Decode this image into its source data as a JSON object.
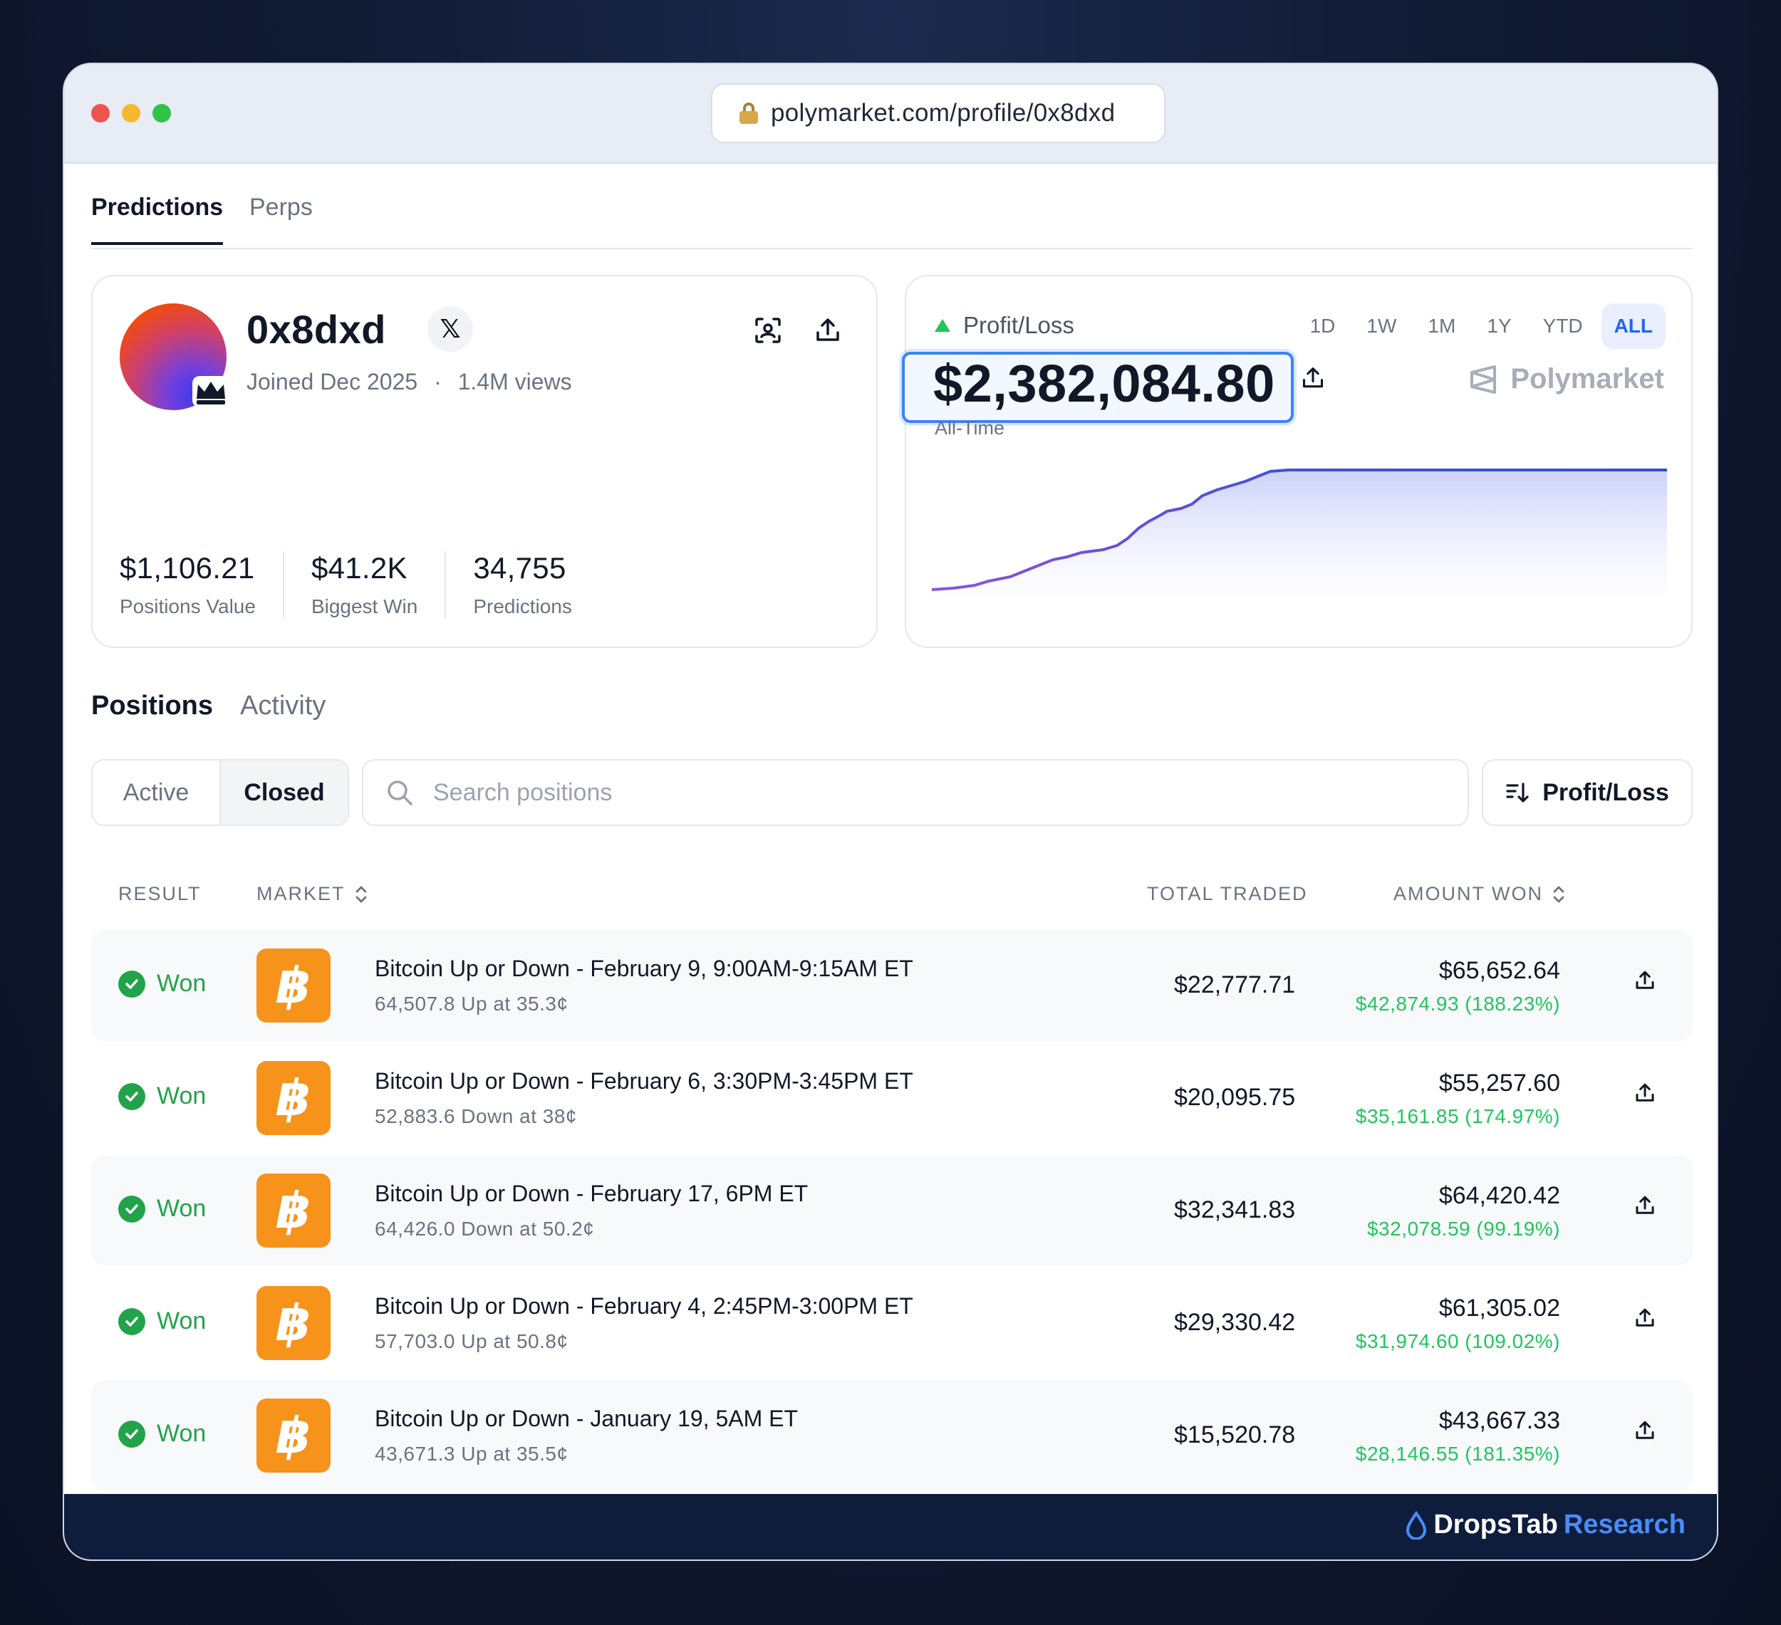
{
  "browser": {
    "url": "polymarket.com/profile/0x8dxd"
  },
  "top_tabs": [
    "Predictions",
    "Perps"
  ],
  "profile": {
    "username": "0x8dxd",
    "x_label": "𝕏",
    "joined": "Joined Dec 2025",
    "views": "1.4M views",
    "stats": [
      {
        "value": "$1,106.21",
        "label": "Positions Value"
      },
      {
        "value": "$41.2K",
        "label": "Biggest Win"
      },
      {
        "value": "34,755",
        "label": "Predictions"
      }
    ]
  },
  "pnl": {
    "title": "Profit/Loss",
    "value": "$2,382,084.80",
    "period": "All-Time",
    "brand": "Polymarket",
    "ranges": [
      "1D",
      "1W",
      "1M",
      "1Y",
      "YTD",
      "ALL"
    ],
    "active_range": "ALL",
    "colors": {
      "line": "#3b52d6",
      "up": "#22c55e",
      "accent": "#2563eb"
    }
  },
  "section_tabs": [
    "Positions",
    "Activity"
  ],
  "filter": {
    "active": "Active",
    "closed": "Closed",
    "search_placeholder": "Search positions",
    "sort_label": "Profit/Loss"
  },
  "table": {
    "headers": {
      "result": "RESULT",
      "market": "MARKET",
      "total": "TOTAL TRADED",
      "amount": "AMOUNT WON"
    },
    "rows": [
      {
        "result": "Won",
        "title": "Bitcoin Up or Down - February 9, 9:00AM-9:15AM ET",
        "sub": "64,507.8 Up at 35.3¢",
        "traded": "$22,777.71",
        "amount": "$65,652.64",
        "gain": "$42,874.93 (188.23%)"
      },
      {
        "result": "Won",
        "title": "Bitcoin Up or Down - February 6, 3:30PM-3:45PM ET",
        "sub": "52,883.6 Down at 38¢",
        "traded": "$20,095.75",
        "amount": "$55,257.60",
        "gain": "$35,161.85 (174.97%)"
      },
      {
        "result": "Won",
        "title": "Bitcoin Up or Down - February 17, 6PM ET",
        "sub": "64,426.0 Down at 50.2¢",
        "traded": "$32,341.83",
        "amount": "$64,420.42",
        "gain": "$32,078.59 (99.19%)"
      },
      {
        "result": "Won",
        "title": "Bitcoin Up or Down - February 4, 2:45PM-3:00PM ET",
        "sub": "57,703.0 Up at 50.8¢",
        "traded": "$29,330.42",
        "amount": "$61,305.02",
        "gain": "$31,974.60 (109.02%)"
      },
      {
        "result": "Won",
        "title": "Bitcoin Up or Down - January 19, 5AM ET",
        "sub": "43,671.3 Up at 35.5¢",
        "traded": "$15,520.78",
        "amount": "$43,667.33",
        "gain": "$28,146.55 (181.35%)"
      }
    ]
  },
  "footer": {
    "brand_main": "DropsTab",
    "brand_accent": "Research"
  }
}
